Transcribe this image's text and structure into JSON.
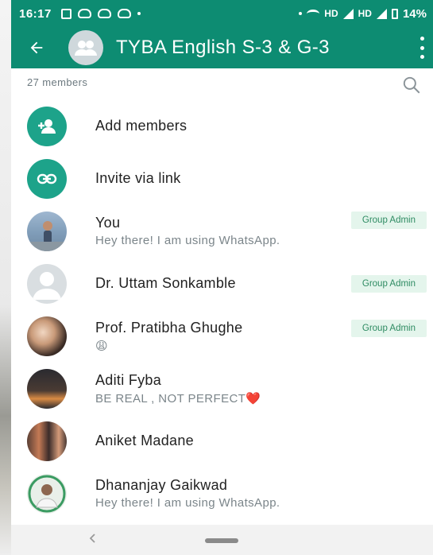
{
  "status_bar": {
    "time": "16:17",
    "network": "HD",
    "network2": "HD",
    "battery": "14%"
  },
  "app_bar": {
    "title": "TYBA English S-3 & G-3",
    "back_icon": "arrow-left-icon",
    "menu_icon": "more-vert-icon"
  },
  "members": {
    "count_label": "27 members",
    "search_icon": "search-icon"
  },
  "actions": [
    {
      "label": "Add members",
      "icon": "add-group-icon"
    },
    {
      "label": "Invite via link",
      "icon": "link-icon"
    }
  ],
  "participants": [
    {
      "name": "You",
      "status": "Hey there! I am using WhatsApp.",
      "badge": "Group Admin"
    },
    {
      "name": "Dr. Uttam Sonkamble",
      "status": "",
      "badge": "Group Admin"
    },
    {
      "name": "Prof. Pratibha Ghughe",
      "status": "😩",
      "badge": "Group Admin"
    },
    {
      "name": "Aditi Fyba",
      "status": "BE REAL , NOT PERFECT❤️",
      "badge": ""
    },
    {
      "name": "Aniket Madane",
      "status": "",
      "badge": ""
    },
    {
      "name": "Dhananjay Gaikwad",
      "status": "Hey there! I am using WhatsApp.",
      "badge": ""
    }
  ],
  "colors": {
    "header": "#0d8c72",
    "accent": "#1da38a",
    "badge_bg": "#e4f5ec",
    "badge_text": "#2e8b62"
  }
}
